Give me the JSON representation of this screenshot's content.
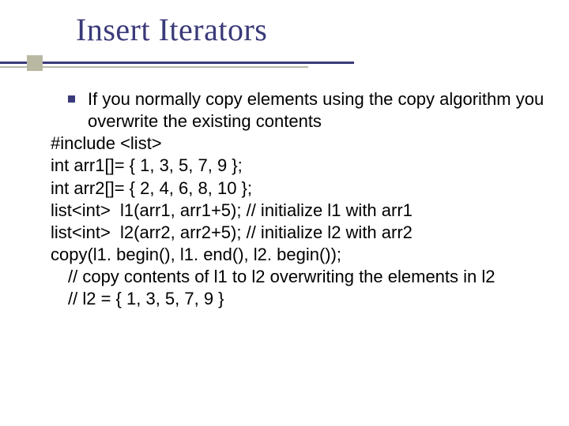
{
  "title": "Insert Iterators",
  "bullet": "If you normally copy elements using the copy algorithm you overwrite the existing contents",
  "lines": {
    "l0": "#include <list>",
    "l1": "int arr1[]= { 1, 3, 5, 7, 9 };",
    "l2": "int arr2[]= { 2, 4, 6, 8, 10 };",
    "l3": "list<int>  l1(arr1, arr1+5); // initialize l1 with arr1",
    "l4": "list<int>  l2(arr2, arr2+5); // initialize l2 with arr2",
    "l5": "copy(l1. begin(), l1. end(), l2. begin());",
    "l6": "// copy contents of l1 to l2 overwriting the elements in l2",
    "l7": "// l2 = { 1, 3, 5, 7, 9 }"
  }
}
